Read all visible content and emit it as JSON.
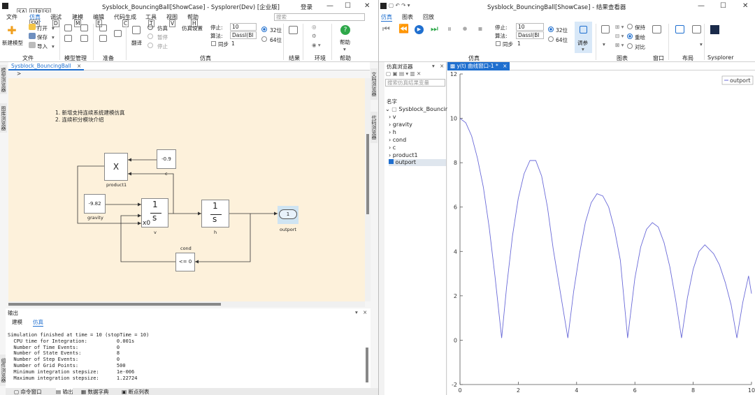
{
  "left_window": {
    "title": "Sysblock_BouncingBall[ShowCase] - Sysplorer(Dev) [企业版]",
    "login": "登录",
    "quick_tabs": [
      "SA",
      "U",
      "R",
      "SI"
    ],
    "menus": [
      "文件",
      "仿真",
      "调试",
      "建模",
      "编辑",
      "代码生成",
      "工具",
      "视图",
      "帮助"
    ],
    "key_tips": [
      "SM",
      "D",
      "M",
      "E",
      "C",
      "T",
      "V",
      "H"
    ],
    "search_placeholder": "搜索",
    "ribbon": {
      "new_model": "新建模型",
      "open": "打开",
      "save": "保存",
      "import": "导入",
      "translate": "翻译",
      "simulate": "仿真",
      "pause": "暂停",
      "stop": "停止",
      "sim_settings": "仿真设置",
      "stop_label": "停止:",
      "stop_value": "10",
      "algo_label": "算法:",
      "algo_value": "Dassl(Bl",
      "sync_label": "同步",
      "sync_value": "1",
      "bit32": "32位",
      "bit64": "64位",
      "groups": [
        "文件",
        "模型管理",
        "准备",
        "仿真",
        "结果",
        "环境",
        "帮助"
      ],
      "help": "帮助"
    },
    "doc_tab": "Sysblock_BouncingBall",
    "breadcrumb": ">",
    "side_tabs_left": [
      "模型浏览器",
      "图库浏览器",
      "组件浏览器"
    ],
    "side_tabs_right": [
      "文档浏览器",
      "代码浏览器"
    ],
    "notes": [
      "1.  新增支持连续系统建模仿真",
      "2.  连续积分模块介绍"
    ],
    "blocks": {
      "product": "X",
      "product_label": "product1",
      "c_value": "-0.9",
      "c_label": "c",
      "gravity_value": "-9.82",
      "gravity_label": "gravity",
      "v_num": "1",
      "v_den": "s",
      "v_label": "v",
      "v_x0": "x0",
      "h_num": "1",
      "h_den": "s",
      "h_label": "h",
      "outport_value": "1",
      "outport_label": "outport",
      "cond_value": "<= 0",
      "cond_label": "cond"
    },
    "output": {
      "title": "输出",
      "tabs": [
        "建模",
        "仿真"
      ],
      "lines": [
        "Simulation finished at time = 10 (stopTime = 10)",
        "  CPU time for Integration:          0.001s",
        "  Number of Time Events:             0",
        "  Number of State Events:            8",
        "  Number of Step Events:             0",
        "  Number of Grid Points:             500",
        "  Minimum integration stepsize:      1e-006",
        "  Maximum integration stepsize:      1.22724"
      ]
    },
    "bottom_tabs": [
      "命令窗口",
      "输出",
      "数据字典",
      "断点列表"
    ]
  },
  "right_window": {
    "title": "Sysblock_BouncingBall[ShowCase] - 结果查看器",
    "menus": [
      "仿真",
      "图表",
      "回放"
    ],
    "ribbon": {
      "stop_label": "停止:",
      "stop_value": "10",
      "algo_label": "算法:",
      "algo_value": "Dassl(Bl",
      "sync_label": "同步",
      "sync_value": "1",
      "bit32": "32位",
      "bit64": "64位",
      "tune": "调参",
      "keep": "保持",
      "redraw": "重绘",
      "compare": "对比",
      "groups": [
        "仿真",
        "图表",
        "窗口",
        "布局",
        "Sysplorer"
      ]
    },
    "browser": {
      "title": "仿真浏览器",
      "search_placeholder": "搜索仿真结果变量",
      "column": "名字",
      "root": "Sysblock_BouncingB",
      "items": [
        "v",
        "gravity",
        "h",
        "cond",
        "c",
        "product1",
        "outport"
      ]
    },
    "plot_tab": "y(t) 曲线窗口-1 *"
  },
  "chart_data": {
    "type": "line",
    "legend": [
      "outport"
    ],
    "legend_position": "top-right",
    "xlim": [
      0,
      10
    ],
    "ylim": [
      -2,
      12
    ],
    "x_ticks": [
      0,
      2,
      4,
      6,
      8,
      10
    ],
    "y_ticks": [
      -2,
      0,
      2,
      4,
      6,
      8,
      10,
      12
    ],
    "series": [
      {
        "name": "outport",
        "color": "#6a6ad8",
        "x": [
          0,
          0.2,
          0.4,
          0.6,
          0.8,
          1.0,
          1.2,
          1.43,
          1.6,
          1.8,
          2.0,
          2.2,
          2.4,
          2.6,
          2.8,
          3.0,
          3.2,
          3.7,
          3.9,
          4.1,
          4.3,
          4.5,
          4.7,
          4.9,
          5.1,
          5.3,
          5.5,
          5.75,
          6.0,
          6.2,
          6.4,
          6.6,
          6.8,
          7.0,
          7.2,
          7.4,
          7.6,
          7.8,
          8.0,
          8.2,
          8.4,
          8.7,
          8.9,
          9.1,
          9.3,
          9.5,
          9.7,
          9.9,
          10.0
        ],
        "y": [
          10.0,
          9.8,
          9.2,
          8.2,
          6.9,
          5.1,
          2.9,
          0.1,
          2.4,
          4.7,
          6.4,
          7.5,
          8.1,
          8.1,
          7.4,
          6.0,
          4.1,
          0.1,
          2.2,
          3.9,
          5.3,
          6.2,
          6.6,
          6.5,
          6.0,
          5.0,
          3.6,
          0.1,
          2.8,
          4.2,
          5.0,
          5.3,
          5.1,
          4.4,
          3.3,
          1.8,
          0.1,
          1.9,
          3.2,
          4.0,
          4.3,
          3.9,
          3.4,
          2.6,
          1.6,
          0.1,
          1.7,
          2.9,
          2.1
        ]
      }
    ]
  }
}
